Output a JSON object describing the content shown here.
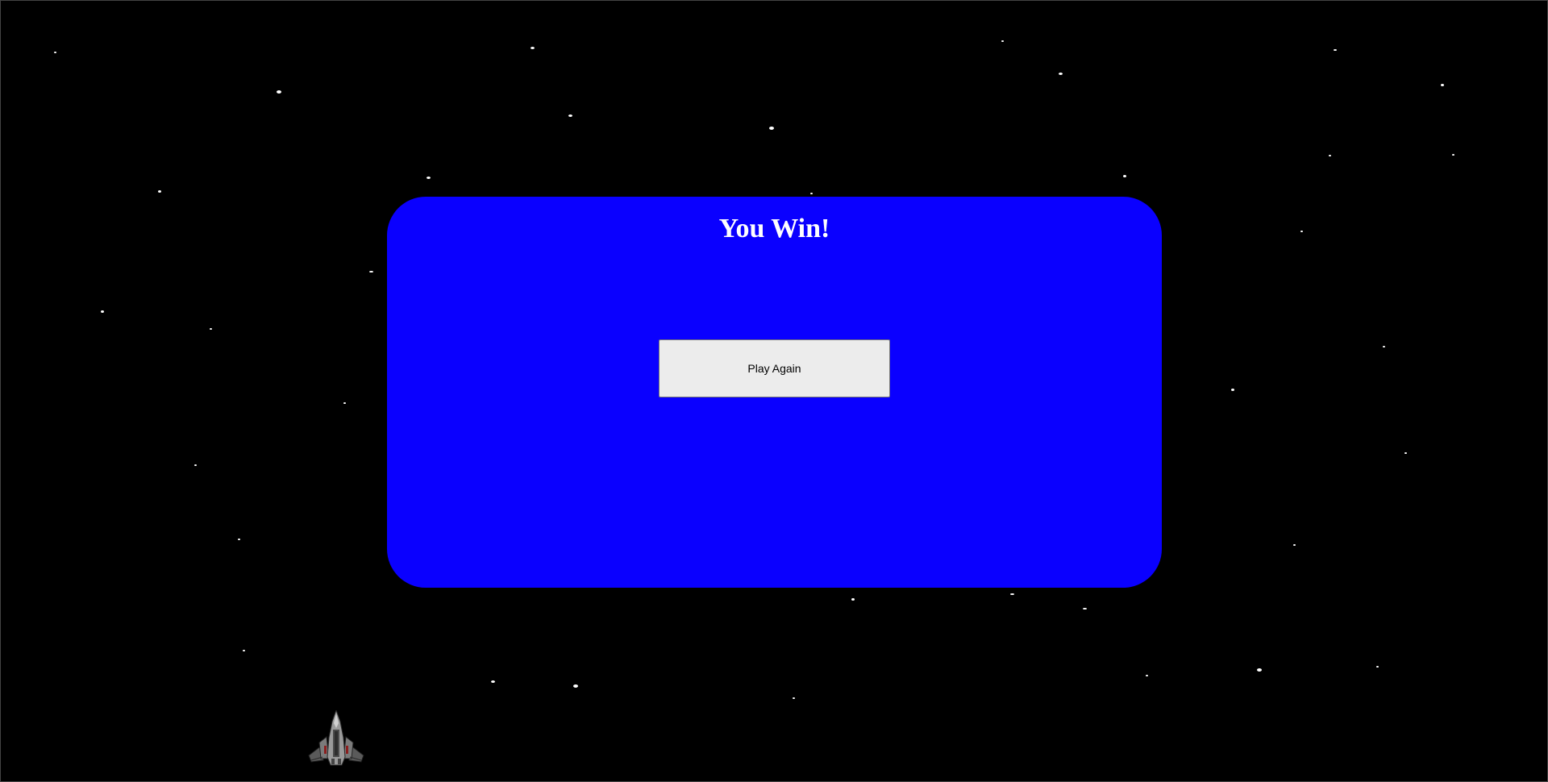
{
  "win_screen": {
    "title": "You Win!",
    "play_again_label": "Play Again"
  },
  "player_ship": {
    "icon": "spaceship-icon"
  },
  "colors": {
    "background": "#000000",
    "panel": "#0a00ff",
    "button": "#ececec",
    "title_text": "#ffffff",
    "star": "#ffffff"
  }
}
